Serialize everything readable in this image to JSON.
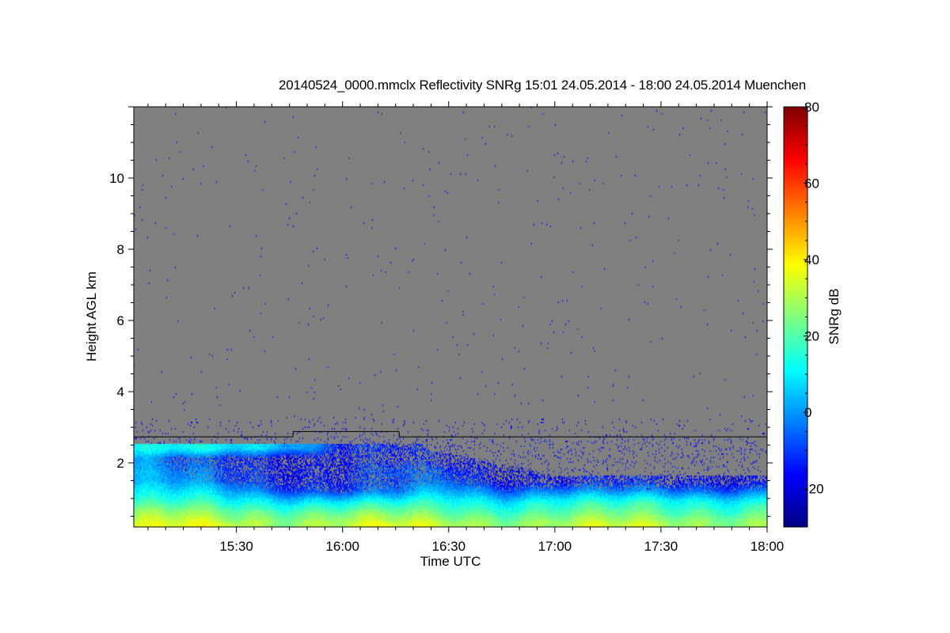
{
  "chart_data": {
    "type": "heatmap",
    "title": "20140524_0000.mmclx Reflectivity SNRg   15:01 24.05.2014 - 18:00 24.05.2014 Muenchen",
    "xlabel": "Time UTC",
    "ylabel": "Height AGL km",
    "colorbar_label": "SNRg dB",
    "xlim": [
      "15:01",
      "18:00"
    ],
    "ylim": [
      0.2,
      12
    ],
    "clim": [
      -30,
      80
    ],
    "colormap": "jet",
    "no_data_color": "#808080",
    "x_ticks": [
      "15:30",
      "16:00",
      "16:30",
      "17:00",
      "17:30",
      "18:00"
    ],
    "y_ticks": [
      "2",
      "4",
      "6",
      "8",
      "10"
    ],
    "colorbar_ticks": [
      "-20",
      "0",
      "20",
      "40",
      "60",
      "80"
    ],
    "grid": false,
    "mask_top_line": [
      {
        "from": "15:01",
        "to": "15:46",
        "height_km": 2.73
      },
      {
        "from": "15:46",
        "to": "16:16",
        "height_km": 2.88
      },
      {
        "from": "16:16",
        "to": "18:00",
        "height_km": 2.73
      }
    ],
    "times": [
      "15:01",
      "15:15",
      "15:30",
      "15:45",
      "16:00",
      "16:15",
      "16:30",
      "16:45",
      "17:00",
      "17:15",
      "17:30",
      "17:45",
      "18:00"
    ],
    "heights_km": [
      0.3,
      0.6,
      0.9,
      1.2,
      1.5,
      1.8,
      2.1,
      2.4
    ],
    "snr_db": [
      [
        33,
        33,
        30,
        32,
        33,
        31,
        30,
        30,
        31,
        30,
        29,
        30,
        31
      ],
      [
        26,
        25,
        22,
        24,
        25,
        22,
        20,
        22,
        23,
        21,
        20,
        22,
        23
      ],
      [
        16,
        15,
        12,
        12,
        12,
        10,
        14,
        12,
        15,
        12,
        13,
        14,
        15
      ],
      [
        8,
        6,
        2,
        -5,
        -8,
        -5,
        4,
        -2,
        0,
        -3,
        -2,
        -3,
        0
      ],
      [
        2,
        -2,
        -8,
        -12,
        -12,
        -10,
        -5,
        -15,
        -15,
        -15,
        -15,
        -15,
        -15
      ],
      [
        2,
        -5,
        -10,
        -12,
        -15,
        -8,
        -10,
        -18,
        null,
        null,
        null,
        null,
        null
      ],
      [
        0,
        -10,
        -12,
        -15,
        -15,
        -15,
        -18,
        null,
        null,
        null,
        null,
        null,
        null
      ],
      [
        10,
        8,
        8,
        8,
        -10,
        -15,
        null,
        null,
        null,
        null,
        null,
        null,
        null
      ]
    ]
  }
}
